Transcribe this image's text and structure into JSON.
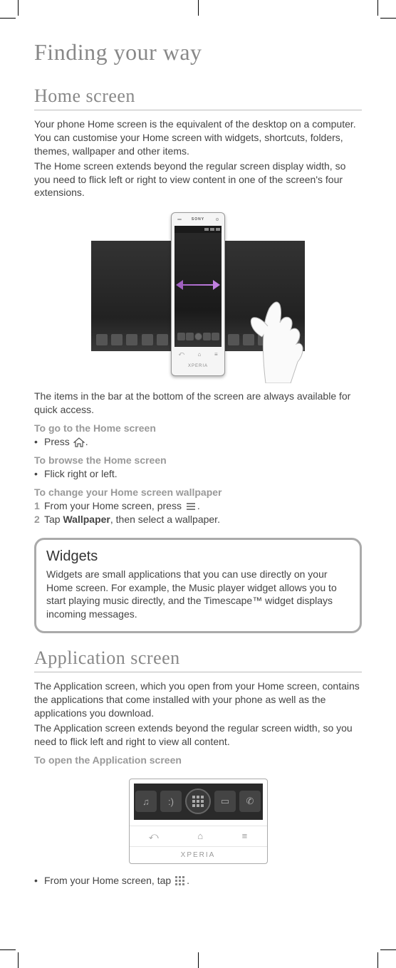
{
  "title": "Finding your way",
  "home_screen": {
    "heading": "Home screen",
    "intro": "Your phone Home screen is the equivalent of the desktop on a computer. You can customise your Home screen with widgets, shortcuts, folders, themes, wallpaper and other items.",
    "intro2": "The Home screen extends beyond the regular screen display width, so you need to flick left or right to view content in one of the screen's four extensions.",
    "after_image": "The items in the bar at the bottom of the screen are always available for quick access.",
    "to_go_home": {
      "heading": "To go to the Home screen",
      "step": "Press",
      "step_suffix": "."
    },
    "to_browse": {
      "heading": "To browse the Home screen",
      "step": "Flick right or left."
    },
    "to_wallpaper": {
      "heading": "To change your Home screen wallpaper",
      "step1_prefix": "From your Home screen, press",
      "step1_suffix": ".",
      "step2_prefix": "Tap ",
      "step2_bold": "Wallpaper",
      "step2_suffix": ", then select a wallpaper."
    }
  },
  "widgets": {
    "title": "Widgets",
    "body": "Widgets are small applications that you can use directly on your Home screen. For example, the Music player widget allows you to start playing music directly, and the Timescape™ widget displays incoming messages."
  },
  "app_screen": {
    "heading": "Application screen",
    "intro": "The Application screen, which you open from your Home screen, contains the applications that come installed with your phone as well as the applications you download.",
    "intro2": "The Application screen extends beyond the regular screen width, so you need to flick left and right to view all content.",
    "to_open_heading": "To open the Application screen",
    "final_step_prefix": "From your Home screen, tap",
    "final_step_suffix": "."
  },
  "phone": {
    "brand": "SONY",
    "sub_brand": "XPERIA"
  }
}
